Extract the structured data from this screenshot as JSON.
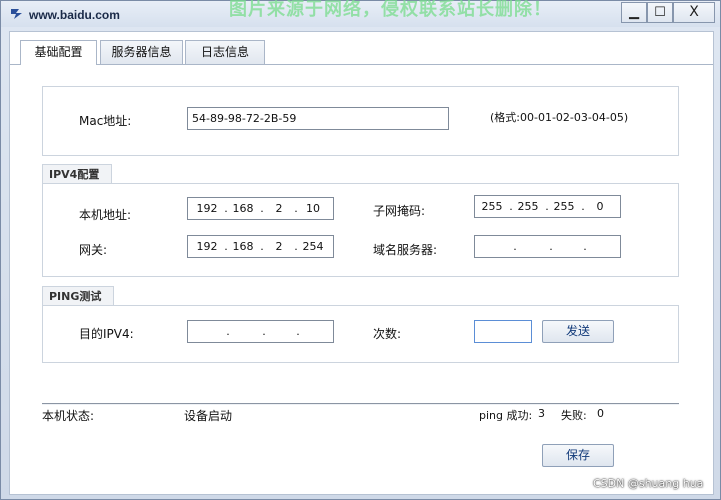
{
  "window": {
    "title": "www.baidu.com",
    "watermark": "图片来源于网络，侵权联系站长删除！",
    "minimize_label": "▁",
    "maximize_label": "☐",
    "close_label": "X"
  },
  "tabs": [
    {
      "label": "基础配置",
      "active": true
    },
    {
      "label": "服务器信息",
      "active": false
    },
    {
      "label": "日志信息",
      "active": false
    }
  ],
  "mac": {
    "label": "Mac地址:",
    "value": "54-89-98-72-2B-59",
    "hint": "(格式:00-01-02-03-04-05)"
  },
  "ipv4": {
    "group_label": "IPV4配置",
    "local_ip_label": "本机地址:",
    "local_ip": [
      "192",
      "168",
      "2",
      "10"
    ],
    "subnet_label": "子网掩码:",
    "subnet": [
      "255",
      "255",
      "255",
      "0"
    ],
    "gateway_label": "网关:",
    "gateway": [
      "192",
      "168",
      "2",
      "254"
    ],
    "dns_label": "域名服务器:",
    "dns": [
      "",
      "",
      "",
      ""
    ]
  },
  "ping": {
    "group_label": "PING测试",
    "target_label": "目的IPV4:",
    "target": [
      "",
      "",
      "",
      ""
    ],
    "count_label": "次数:",
    "count_value": "",
    "send_label": "发送"
  },
  "status": {
    "label": "本机状态:",
    "value": "设备启动",
    "ping_success_label": "ping 成功:",
    "ping_success": "3",
    "fail_label": "失败:",
    "fail": "0"
  },
  "save_label": "保存",
  "credit": "CSDN @shuang hua"
}
